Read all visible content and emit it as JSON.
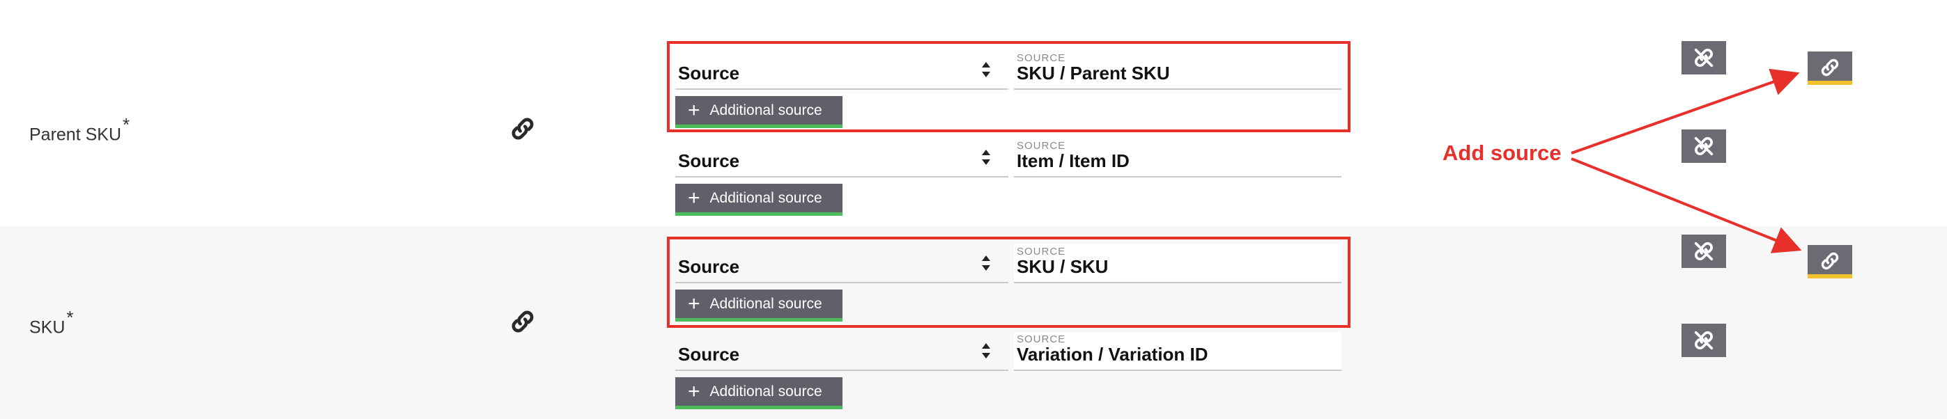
{
  "rows": [
    {
      "field_label": "Parent SKU",
      "required_mark": "*",
      "entries": [
        {
          "select_value": "Source",
          "source_caption": "SOURCE",
          "source_value": "SKU / Parent SKU",
          "button_label": "Additional source"
        },
        {
          "select_value": "Source",
          "source_caption": "SOURCE",
          "source_value": "Item / Item ID",
          "button_label": "Additional source"
        }
      ]
    },
    {
      "field_label": "SKU",
      "required_mark": "*",
      "entries": [
        {
          "select_value": "Source",
          "source_caption": "SOURCE",
          "source_value": "SKU / SKU",
          "button_label": "Additional source"
        },
        {
          "select_value": "Source",
          "source_caption": "SOURCE",
          "source_value": "Variation / Variation ID",
          "button_label": "Additional source"
        }
      ]
    }
  ],
  "annotation": {
    "label": "Add source"
  },
  "icons": {
    "row_link": "link-icon",
    "unlink": "unlink-icon",
    "add_link": "link-icon"
  },
  "colors": {
    "highlight": "#e8302b",
    "button_bg": "#5f6069",
    "button_accent": "#4cbb5a",
    "add_link_accent": "#f2c12e"
  }
}
